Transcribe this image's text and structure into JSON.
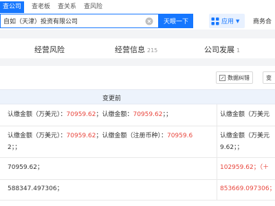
{
  "topnav": {
    "tabs": [
      "查公司",
      "查老板",
      "查关系",
      "查风险"
    ]
  },
  "search": {
    "value": "自如（天津）投资有限公司",
    "button_label": "天眼一下"
  },
  "header": {
    "apps_label": "应用",
    "bizcare_label": "商务合"
  },
  "section_tabs": [
    {
      "label": "经营风险",
      "count": ""
    },
    {
      "label": "经营信息",
      "count": "215"
    },
    {
      "label": "公司发展",
      "count": "1"
    }
  ],
  "toolbar": {
    "correction_label": "数据纠错",
    "more_label": "变"
  },
  "table": {
    "header_before": "变更前",
    "rows": [
      {
        "left_line1_parts": [
          "认缴金额（万美元）：",
          "70959.62",
          "；认缴金额：",
          "70959.62",
          "；；"
        ],
        "left_line2": "",
        "right_line1": "认缴金额（万美元",
        "right_line2": ""
      },
      {
        "left_line1_parts": [
          "认缴金额（万美元）：",
          "70959.62",
          "；认缴金额（注册币种）：",
          "70959.6",
          ""
        ],
        "left_line2": "2；；",
        "right_line1": "认缴金额（万美元",
        "right_line2": "9.62；；"
      },
      {
        "left_value": "70959.62；",
        "right_value": "102959.62；（＋"
      },
      {
        "left_value": "588347.497306；",
        "right_value": "853669.097306；"
      }
    ]
  },
  "colors": {
    "accent": "#1677ff",
    "change_red": "#e8453c",
    "header_bg": "#edf3fc"
  },
  "icons": [
    "clear-circle-icon",
    "app-grid-icon",
    "caret-down-icon",
    "edit-icon"
  ]
}
